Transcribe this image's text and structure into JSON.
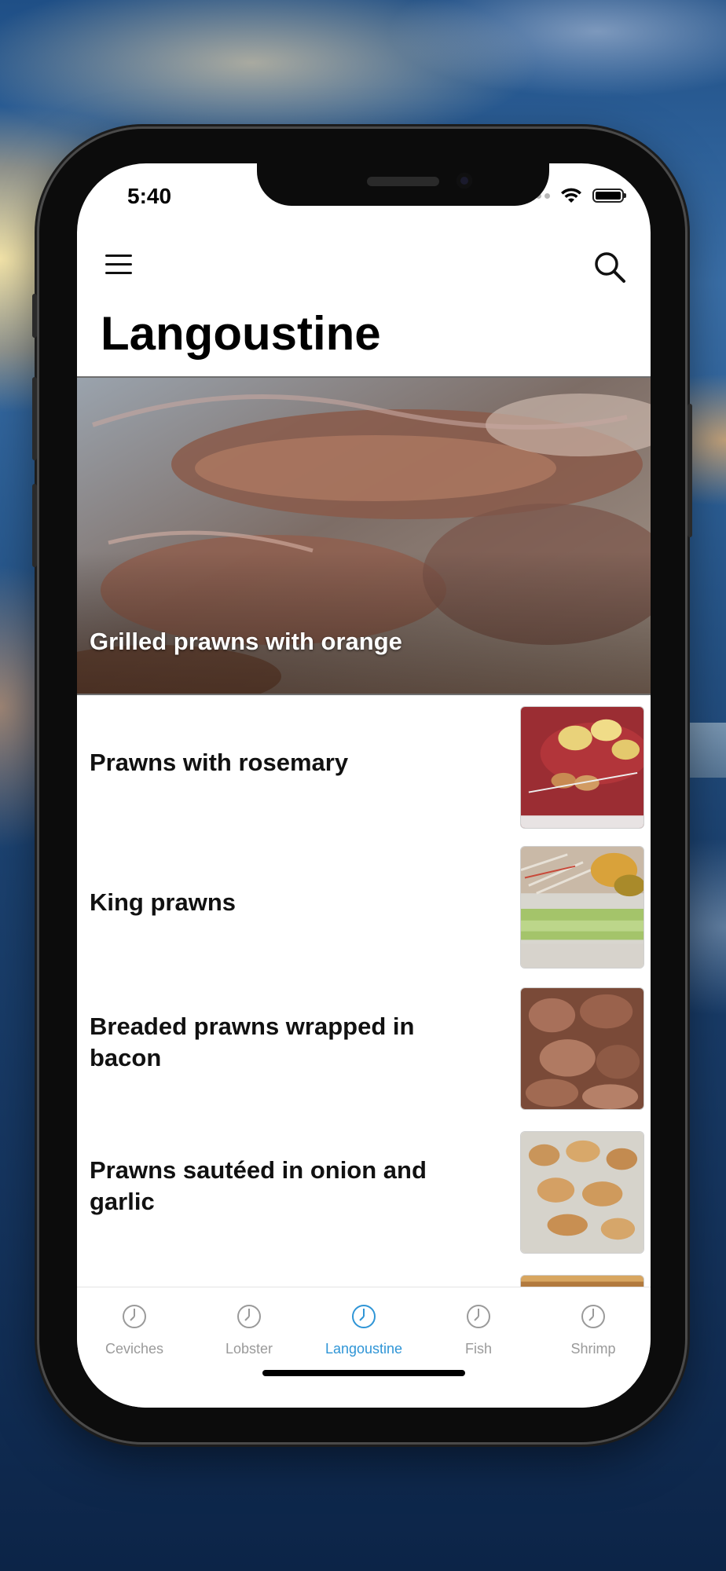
{
  "status": {
    "time": "5:40"
  },
  "header": {
    "title": "Langoustine",
    "menu_icon": "hamburger-menu-icon",
    "search_icon": "search-icon"
  },
  "featured": {
    "title": "Grilled prawns with orange"
  },
  "recipes": [
    {
      "title": "Prawns with rosemary"
    },
    {
      "title": "King prawns"
    },
    {
      "title": "Breaded prawns wrapped in bacon"
    },
    {
      "title": "Prawns sautéed in onion and garlic"
    }
  ],
  "tabs": [
    {
      "label": "Ceviches",
      "icon": "clock-icon",
      "active": false
    },
    {
      "label": "Lobster",
      "icon": "clock-icon",
      "active": false
    },
    {
      "label": "Langoustine",
      "icon": "clock-icon",
      "active": true
    },
    {
      "label": "Fish",
      "icon": "clock-icon",
      "active": false
    },
    {
      "label": "Shrimp",
      "icon": "clock-icon",
      "active": false
    }
  ],
  "colors": {
    "accent": "#2f95d6",
    "inactive": "#9a9a9a"
  }
}
